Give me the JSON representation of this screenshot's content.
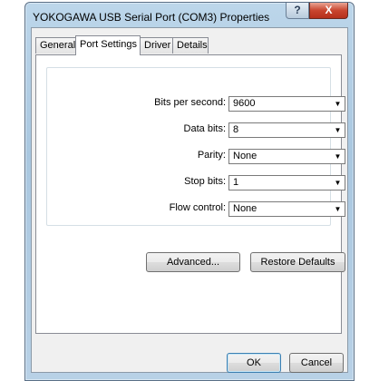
{
  "window": {
    "title": "YOKOGAWA USB Serial Port (COM3) Properties",
    "help_symbol": "?",
    "close_symbol": "X"
  },
  "tabs": [
    {
      "label": "General"
    },
    {
      "label": "Port Settings"
    },
    {
      "label": "Driver"
    },
    {
      "label": "Details"
    }
  ],
  "active_tab": "Port Settings",
  "settings": {
    "bits_per_second": {
      "label": "Bits per second:",
      "value": "9600"
    },
    "data_bits": {
      "label": "Data bits:",
      "value": "8"
    },
    "parity": {
      "label": "Parity:",
      "value": "None"
    },
    "stop_bits": {
      "label": "Stop bits:",
      "value": "1"
    },
    "flow_control": {
      "label": "Flow control:",
      "value": "None"
    }
  },
  "buttons": {
    "advanced": "Advanced...",
    "restore_defaults": "Restore Defaults",
    "ok": "OK",
    "cancel": "Cancel"
  },
  "icons": {
    "dropdown": "▼"
  }
}
